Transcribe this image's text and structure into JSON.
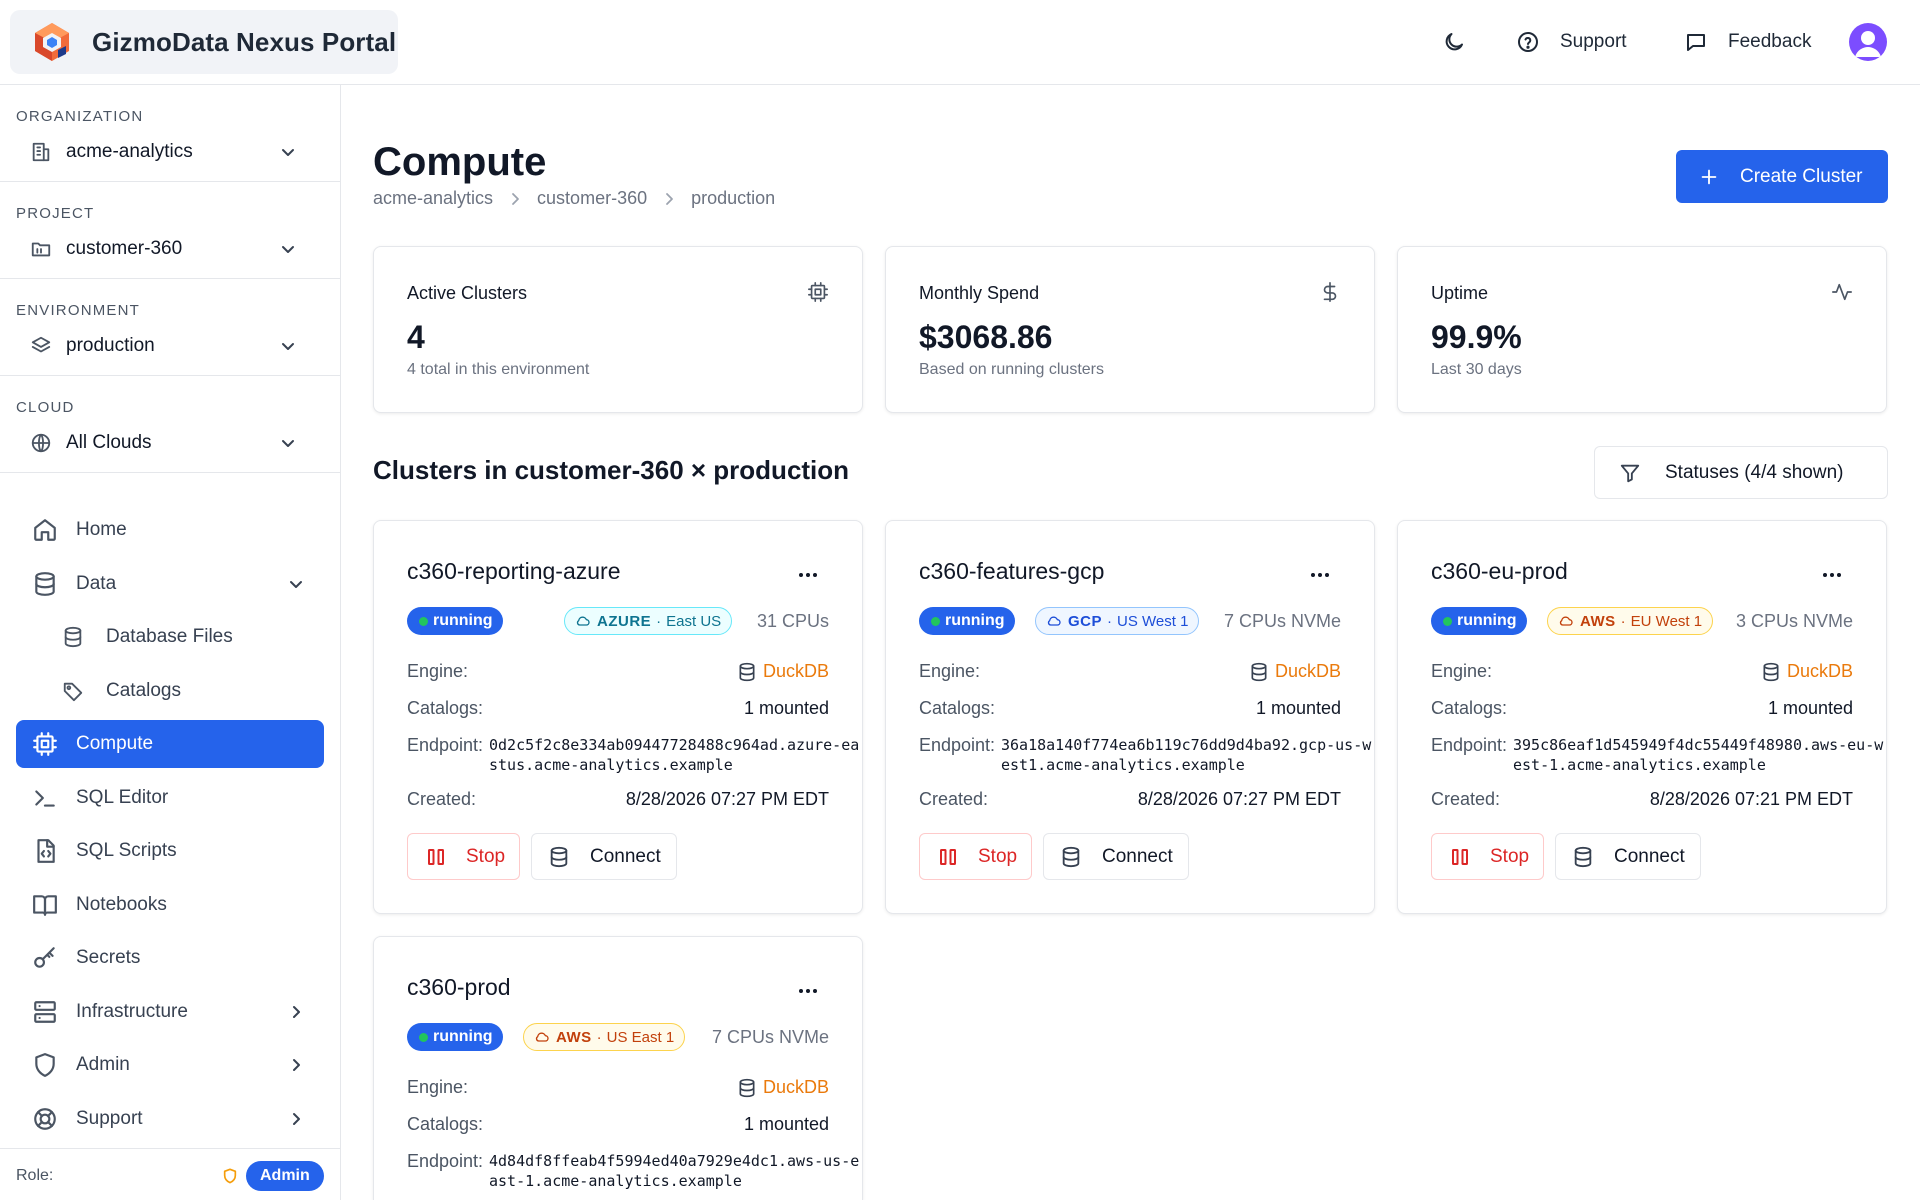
{
  "app": {
    "title": "GizmoData Nexus Portal",
    "header": {
      "support": "Support",
      "feedback": "Feedback"
    }
  },
  "sidebar": {
    "selectors": [
      {
        "label": "ORGANIZATION",
        "value": "acme-analytics",
        "icon": "building-icon"
      },
      {
        "label": "PROJECT",
        "value": "customer-360",
        "icon": "folder-icon"
      },
      {
        "label": "ENVIRONMENT",
        "value": "production",
        "icon": "layers-icon"
      },
      {
        "label": "CLOUD",
        "value": "All Clouds",
        "icon": "globe-icon"
      }
    ],
    "nav": [
      {
        "label": "Home",
        "icon": "home-icon"
      },
      {
        "label": "Data",
        "icon": "database-icon",
        "expanded": true
      },
      {
        "label": "Database Files",
        "icon": "database-icon",
        "sub": true
      },
      {
        "label": "Catalogs",
        "icon": "tag-icon",
        "sub": true
      },
      {
        "label": "Compute",
        "icon": "cpu-icon",
        "active": true
      },
      {
        "label": "SQL Editor",
        "icon": "terminal-icon"
      },
      {
        "label": "SQL Scripts",
        "icon": "file-code-icon"
      },
      {
        "label": "Notebooks",
        "icon": "book-open-icon"
      },
      {
        "label": "Secrets",
        "icon": "key-icon"
      },
      {
        "label": "Infrastructure",
        "icon": "server-icon"
      },
      {
        "label": "Admin",
        "icon": "shield-icon"
      },
      {
        "label": "Support",
        "icon": "life-buoy-icon"
      }
    ],
    "role_label": "Role:",
    "role_value": "Admin"
  },
  "page": {
    "title": "Compute",
    "breadcrumb": [
      "acme-analytics",
      "customer-360",
      "production"
    ],
    "create_button": "Create Cluster",
    "section_title": "Clusters in customer-360 × production",
    "filter_button": "Statuses (4/4 shown)"
  },
  "stats": [
    {
      "title": "Active Clusters",
      "value": "4",
      "sub": "4 total in this environment",
      "icon": "cpu-icon"
    },
    {
      "title": "Monthly Spend",
      "value": "$3068.86",
      "sub": "Based on running clusters",
      "icon": "dollar-icon"
    },
    {
      "title": "Uptime",
      "value": "99.9%",
      "sub": "Last 30 days",
      "icon": "activity-icon"
    }
  ],
  "cluster_labels": {
    "engine": "Engine:",
    "catalogs": "Catalogs:",
    "endpoint": "Endpoint:",
    "created": "Created:",
    "stop": "Stop",
    "connect": "Connect"
  },
  "clusters": [
    {
      "name": "c360-reporting-azure",
      "status": "running",
      "provider": "AZURE",
      "region": "East US",
      "cpus": "31 CPUs",
      "engine": "DuckDB",
      "catalogs": "1 mounted",
      "endpoint": "0d2c5f2c8e334ab09447728488c964ad.azure-eastus.acme-analytics.example",
      "created": "8/28/2026 07:27 PM EDT"
    },
    {
      "name": "c360-features-gcp",
      "status": "running",
      "provider": "GCP",
      "region": "US West 1",
      "cpus": "7 CPUs NVMe",
      "engine": "DuckDB",
      "catalogs": "1 mounted",
      "endpoint": "36a18a140f774ea6b119c76dd9d4ba92.gcp-us-west1.acme-analytics.example",
      "created": "8/28/2026 07:27 PM EDT"
    },
    {
      "name": "c360-eu-prod",
      "status": "running",
      "provider": "AWS",
      "region": "EU West 1",
      "cpus": "3 CPUs NVMe",
      "engine": "DuckDB",
      "catalogs": "1 mounted",
      "endpoint": "395c86eaf1d545949f4dc55449f48980.aws-eu-west-1.acme-analytics.example",
      "created": "8/28/2026 07:21 PM EDT"
    },
    {
      "name": "c360-prod",
      "status": "running",
      "provider": "AWS",
      "region": "US East 1",
      "cpus": "7 CPUs NVMe",
      "engine": "DuckDB",
      "catalogs": "1 mounted",
      "endpoint": "4d84df8ffeab4f5994ed40a7929e4dc1.aws-us-east-1.acme-analytics.example"
    }
  ],
  "colors": {
    "accent": "#2563eb",
    "running_dot": "#22c55e",
    "stop": "#dc2626",
    "engine": "#ea7a0c"
  }
}
